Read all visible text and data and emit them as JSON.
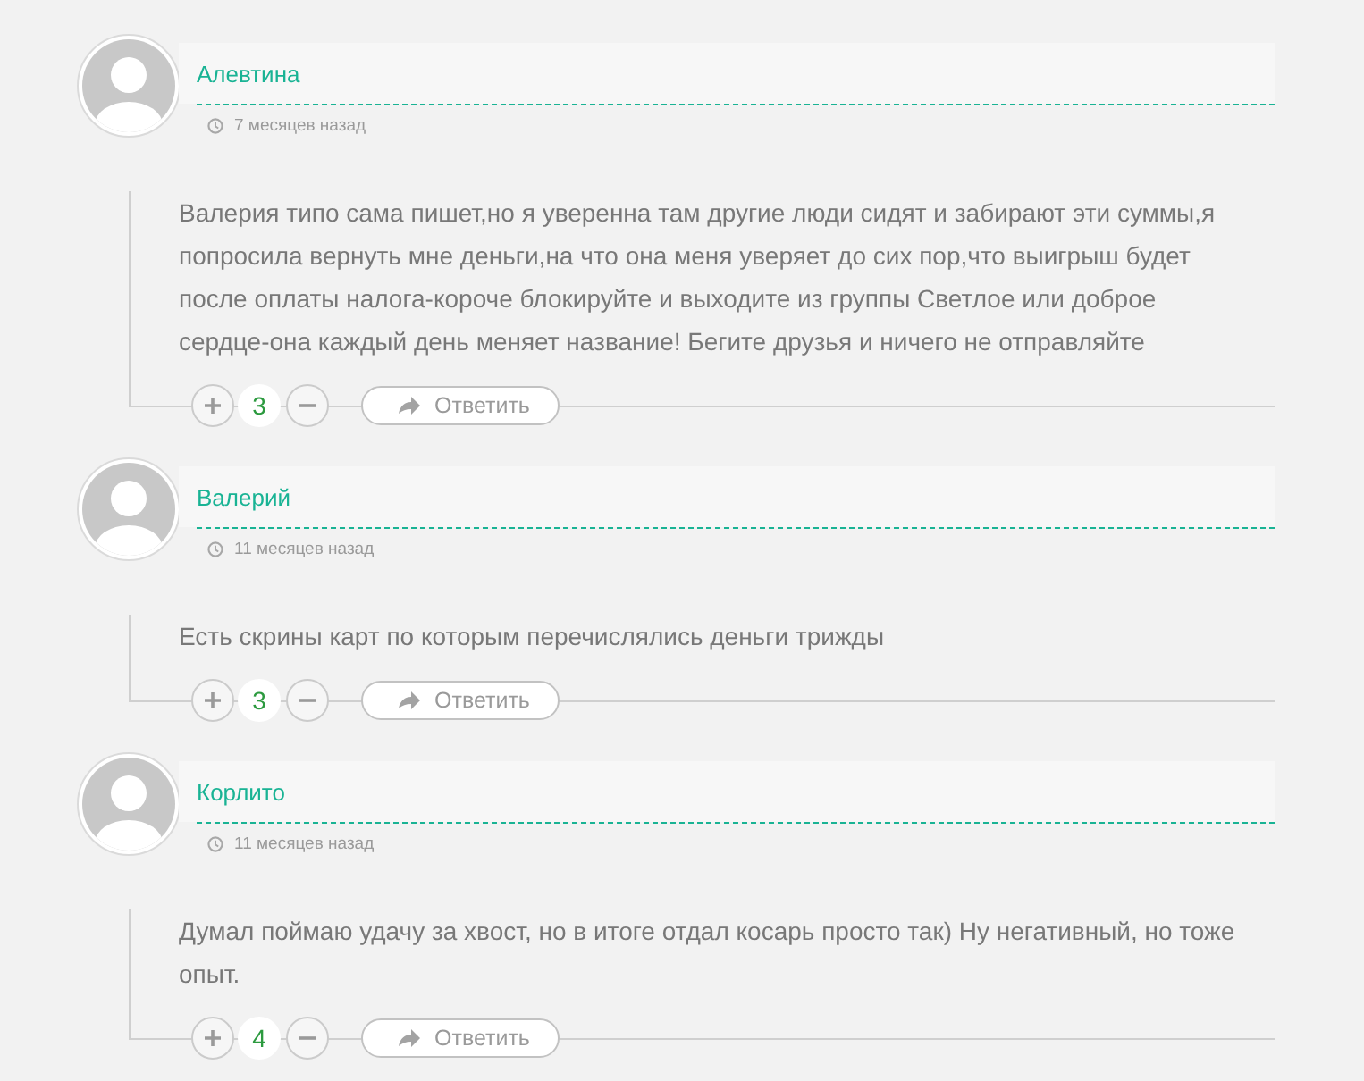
{
  "comments": [
    {
      "author": "Алевтина",
      "time": "7 месяцев назад",
      "text": "Валерия типо сама пишет,но я уверенна там другие люди сидят и забирают эти суммы,я попросила вернуть мне деньги,на что она меня уверяет до сих пор,что выигрыш будет после оплаты налога-короче блокируйте и выходите из группы Светлое или доброе сердце-она каждый день меняет название! Бегите друзья и ничего не отправляйте",
      "votes": "3",
      "reply": "Ответить"
    },
    {
      "author": "Валерий",
      "time": "11 месяцев назад",
      "text": "Есть скрины карт по которым перечислялись деньги трижды",
      "votes": "3",
      "reply": "Ответить"
    },
    {
      "author": "Корлито",
      "time": "11 месяцев назад",
      "text": "Думал поймаю удачу за хвост, но в итоге отдал косарь просто так) Ну негативный, но тоже опыт.",
      "votes": "4",
      "reply": "Ответить"
    }
  ]
}
